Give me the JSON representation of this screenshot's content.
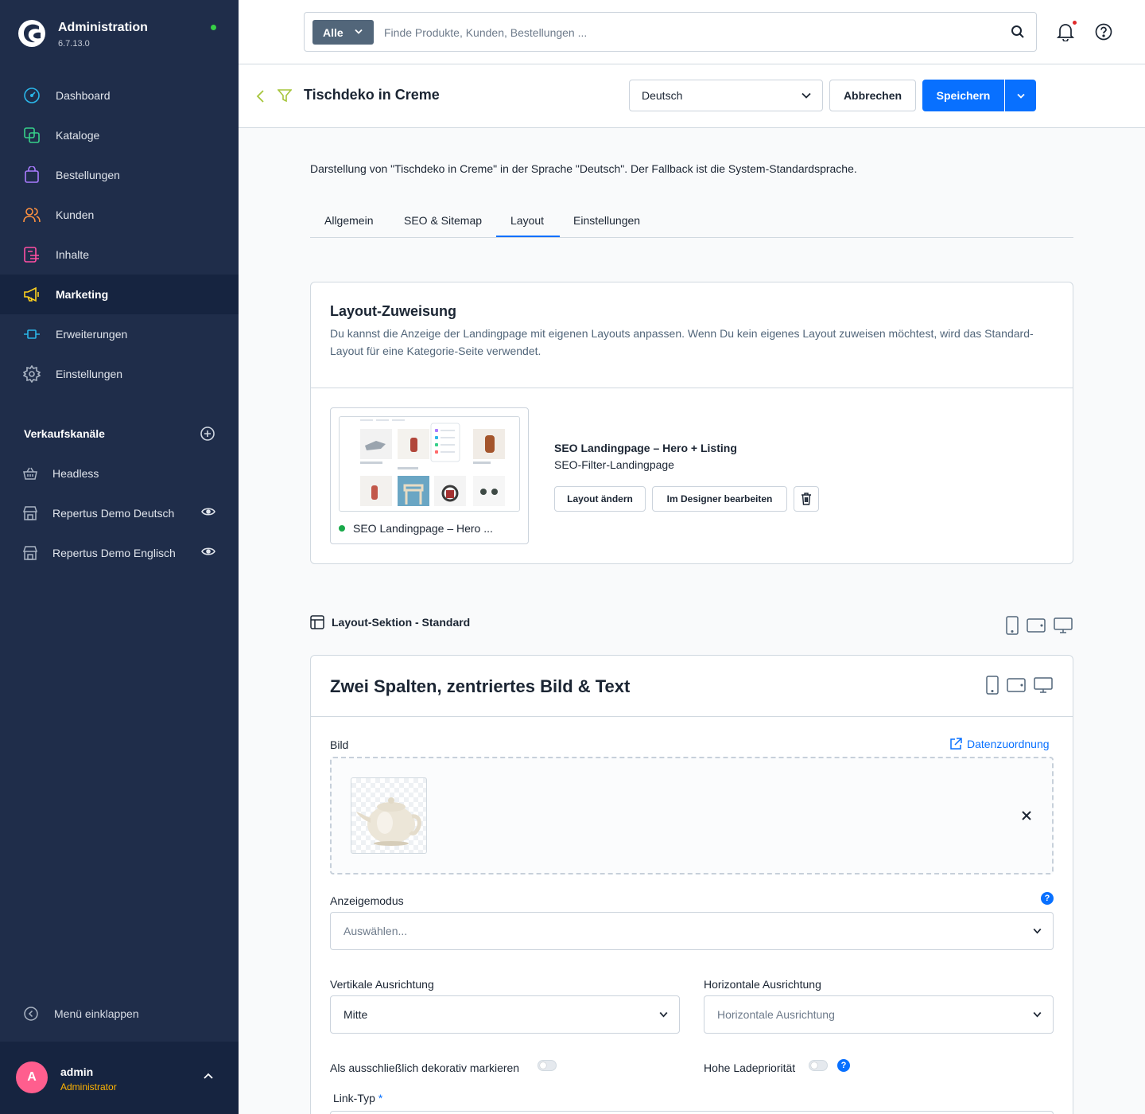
{
  "brand": {
    "title": "Administration",
    "version": "6.7.13.0"
  },
  "nav": {
    "items": [
      {
        "label": "Dashboard",
        "icon": "dashboard-icon"
      },
      {
        "label": "Kataloge",
        "icon": "catalog-icon"
      },
      {
        "label": "Bestellungen",
        "icon": "orders-icon"
      },
      {
        "label": "Kunden",
        "icon": "customers-icon"
      },
      {
        "label": "Inhalte",
        "icon": "content-icon"
      },
      {
        "label": "Marketing",
        "icon": "marketing-icon",
        "active": true
      },
      {
        "label": "Erweiterungen",
        "icon": "extensions-icon"
      },
      {
        "label": "Einstellungen",
        "icon": "settings-icon"
      }
    ]
  },
  "sales_channels": {
    "heading": "Verkaufskanäle",
    "items": [
      {
        "label": "Headless"
      },
      {
        "label": "Repertus Demo Deutsch"
      },
      {
        "label": "Repertus Demo Englisch"
      }
    ]
  },
  "sidebar_footer": {
    "collapse_label": "Menü einklappen"
  },
  "user": {
    "initial": "A",
    "name": "admin",
    "role": "Administrator"
  },
  "search": {
    "type_label": "Alle",
    "placeholder": "Finde Produkte, Kunden, Bestellungen ..."
  },
  "smartbar": {
    "title": "Tischdeko in Creme",
    "language": "Deutsch",
    "cancel_label": "Abbrechen",
    "save_label": "Speichern"
  },
  "content": {
    "language_info": "Darstellung von \"Tischdeko in Creme\" in der Sprache \"Deutsch\". Der Fallback ist die System-Standardsprache.",
    "tabs": [
      "Allgemein",
      "SEO & Sitemap",
      "Layout",
      "Einstellungen"
    ],
    "active_tab": "Layout"
  },
  "layout_assignment": {
    "title": "Layout-Zuweisung",
    "description": "Du kannst die Anzeige der Landingpage mit eigenen Layouts anpassen. Wenn Du kein eigenes Layout zuweisen möchtest, wird das Standard-Layout für eine Kategorie-Seite verwendet.",
    "thumb_caption": "SEO Landingpage – Hero ...",
    "layout_name": "SEO Landingpage – Hero + Listing",
    "layout_type": "SEO-Filter-Landingpage",
    "change_label": "Layout ändern",
    "designer_label": "Im Designer bearbeiten"
  },
  "section": {
    "label": "Layout-Sektion - Standard"
  },
  "block": {
    "title": "Zwei Spalten, zentriertes Bild & Text",
    "image_label": "Bild",
    "data_mapping_label": "Datenzuordnung",
    "display_mode_label": "Anzeigemodus",
    "display_mode_placeholder": "Auswählen...",
    "vertical_label": "Vertikale Ausrichtung",
    "vertical_value": "Mitte",
    "horizontal_label": "Horizontale Ausrichtung",
    "horizontal_placeholder": "Horizontale Ausrichtung",
    "decorative_label": "Als ausschließlich dekorativ markieren",
    "priority_label": "Hohe Ladepriorität",
    "link_type_label": "Link-Typ",
    "required_mark": "*"
  },
  "colors": {
    "sidebar": "#1f2d4a",
    "sidebar_active": "#162440",
    "primary": "#0870ff",
    "role": "#ffb300",
    "avatar": "#ff5e8e",
    "online": "#37d046"
  }
}
